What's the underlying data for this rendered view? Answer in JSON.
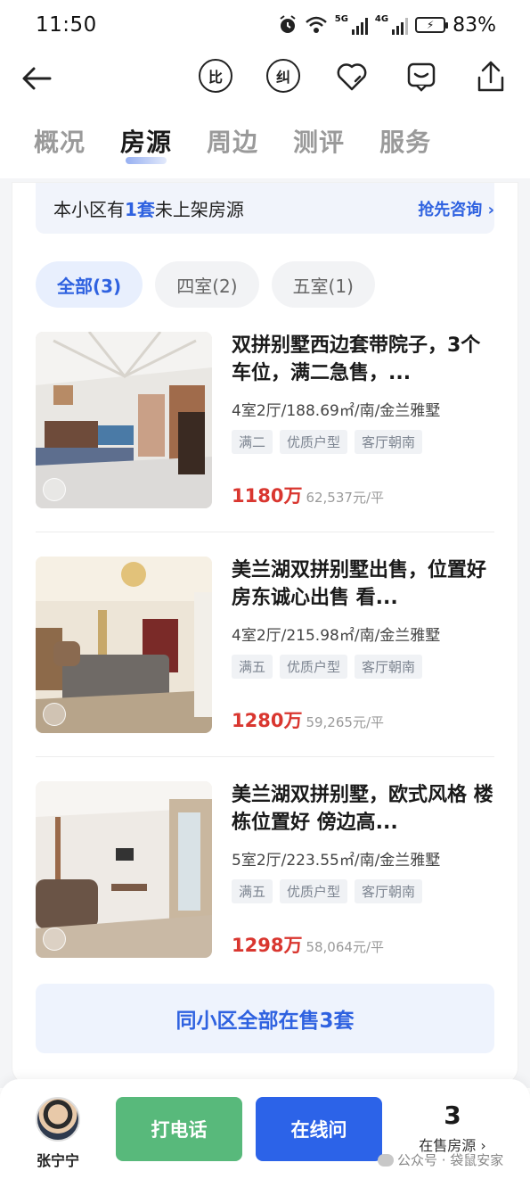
{
  "status_bar": {
    "time": "11:50",
    "battery": "83%",
    "net1": "5G",
    "net2": "4G"
  },
  "nav": {
    "compare_label": "比",
    "correct_label": "纠"
  },
  "tabs": [
    {
      "label": "概况"
    },
    {
      "label": "房源",
      "active": true
    },
    {
      "label": "周边"
    },
    {
      "label": "测评"
    },
    {
      "label": "服务"
    }
  ],
  "notice": {
    "prefix": "本小区有",
    "count": "1套",
    "suffix": "未上架房源",
    "link": "抢先咨询 ›"
  },
  "filters": [
    {
      "label": "全部(3)",
      "active": true
    },
    {
      "label": "四室(2)"
    },
    {
      "label": "五室(1)"
    }
  ],
  "listings": [
    {
      "title": "双拼别墅西边套带院子，3个车位，满二急售，...",
      "meta": "4室2厅/188.69㎡/南/金兰雅墅",
      "tags": [
        "满二",
        "优质户型",
        "客厅朝南"
      ],
      "price": "1180万",
      "unit_price": "62,537元/平"
    },
    {
      "title": "美兰湖双拼别墅出售，位置好 房东诚心出售 看...",
      "meta": "4室2厅/215.98㎡/南/金兰雅墅",
      "tags": [
        "满五",
        "优质户型",
        "客厅朝南"
      ],
      "price": "1280万",
      "unit_price": "59,265元/平"
    },
    {
      "title": "美兰湖双拼别墅，欧式风格 楼栋位置好 傍边高...",
      "meta": "5室2厅/223.55㎡/南/金兰雅墅",
      "tags": [
        "满五",
        "优质户型",
        "客厅朝南"
      ],
      "price": "1298万",
      "unit_price": "58,064元/平"
    }
  ],
  "all_for_sale_button": "同小区全部在售3套",
  "bottom_bar": {
    "agent_name": "张宁宁",
    "call_label": "打电话",
    "chat_label": "在线问",
    "for_sale_count": "3",
    "for_sale_label": "在售房源 ›",
    "watermark": "公众号 · 袋鼠安家"
  },
  "colors": {
    "accent": "#2f62e0",
    "price": "#d9362f",
    "call": "#58b97b",
    "chat": "#2c63e8"
  }
}
